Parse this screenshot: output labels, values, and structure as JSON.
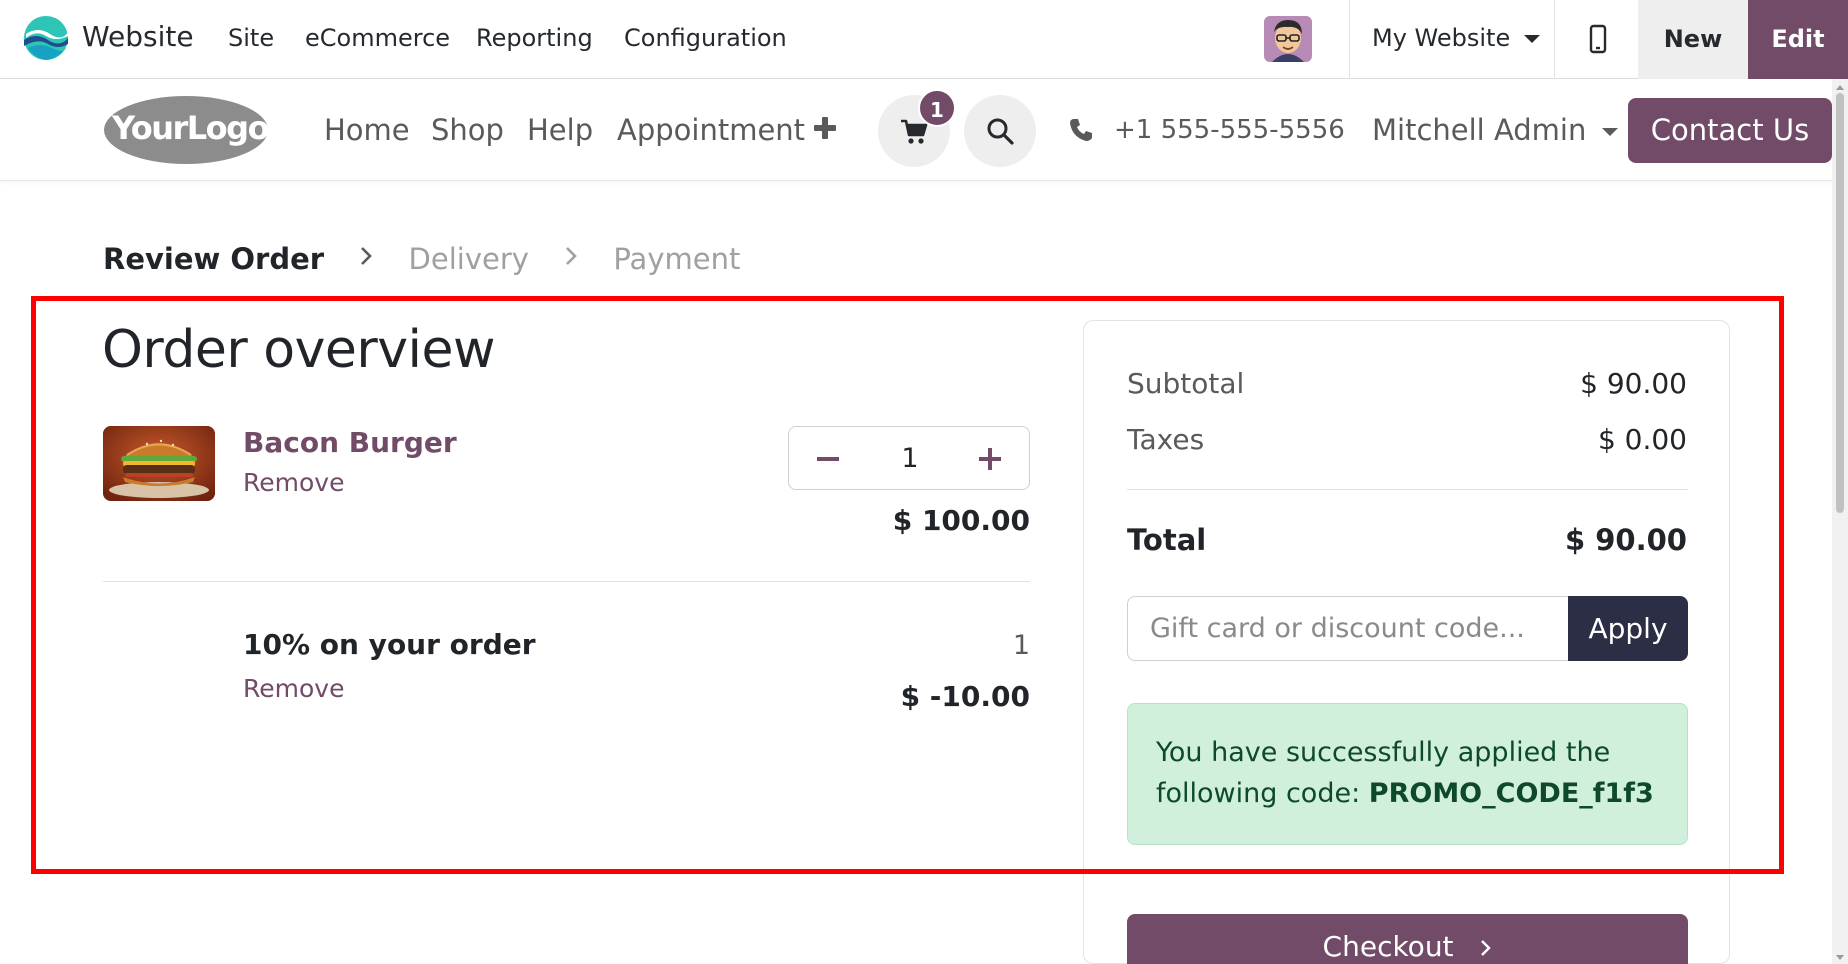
{
  "admin_bar": {
    "app_name": "Website",
    "menus": [
      "Site",
      "eCommerce",
      "Reporting",
      "Configuration"
    ],
    "website_selector": "My Website",
    "new_label": "New",
    "edit_label": "Edit"
  },
  "site_header": {
    "logo_text": "YourLogo",
    "nav": [
      "Home",
      "Shop",
      "Help",
      "Appointment"
    ],
    "cart_count": "1",
    "phone": "+1 555-555-5556",
    "user": "Mitchell Admin",
    "contact_label": "Contact Us"
  },
  "steps": {
    "active": "Review Order",
    "step2": "Delivery",
    "step3": "Payment"
  },
  "order": {
    "title": "Order overview",
    "lines": [
      {
        "name": "Bacon Burger",
        "remove": "Remove",
        "quantity": "1",
        "price": "$ 100.00"
      },
      {
        "name": "10% on your order",
        "remove": "Remove",
        "quantity": "1",
        "price": "$ -10.00"
      }
    ]
  },
  "summary": {
    "subtotal_label": "Subtotal",
    "subtotal_value": "$ 90.00",
    "taxes_label": "Taxes",
    "taxes_value": "$ 0.00",
    "total_label": "Total",
    "total_value": "$ 90.00",
    "promo_placeholder": "Gift card or discount code...",
    "apply_label": "Apply",
    "success_text": "You have successfully applied the following code:",
    "success_code": "PROMO_CODE_f1f3",
    "checkout_label": "Checkout"
  },
  "colors": {
    "brand": "#714b67",
    "apply_button": "#2b2e45",
    "alert_bg": "#d1f0dc",
    "highlight_frame": "#ff0000"
  },
  "icons": [
    "website-app-icon",
    "mobile-preview-icon",
    "plus-icon",
    "cart-icon",
    "search-icon",
    "phone-icon",
    "chevron-right-icon",
    "minus-icon"
  ]
}
